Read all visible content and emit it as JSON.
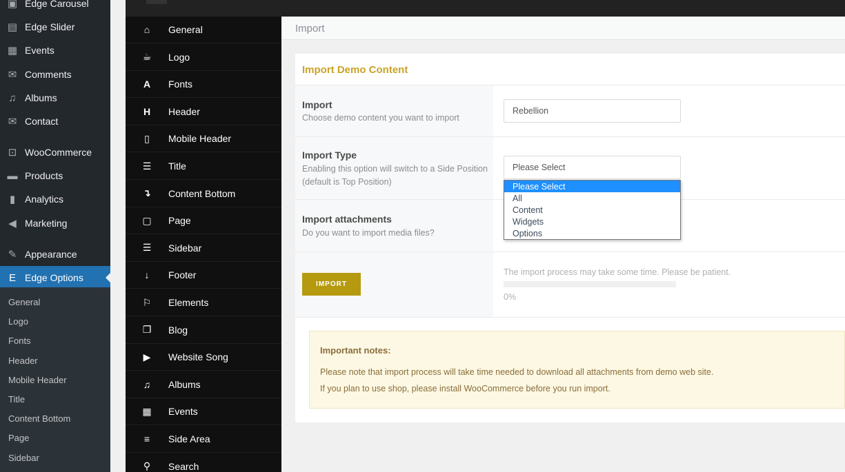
{
  "wp_menu": {
    "items": [
      {
        "label": "Edge Carousel",
        "icon": "carousel-icon",
        "glyph": "▣"
      },
      {
        "label": "Edge Slider",
        "icon": "slider-icon",
        "glyph": "▤"
      },
      {
        "label": "Events",
        "icon": "calendar-icon",
        "glyph": "▦"
      },
      {
        "label": "Comments",
        "icon": "comment-icon",
        "glyph": "✉"
      },
      {
        "label": "Albums",
        "icon": "music-icon",
        "glyph": "♫"
      },
      {
        "label": "Contact",
        "icon": "mail-icon",
        "glyph": "✉"
      },
      {
        "label": "WooCommerce",
        "icon": "woocommerce-icon",
        "glyph": "⊡"
      },
      {
        "label": "Products",
        "icon": "archive-icon",
        "glyph": "▬"
      },
      {
        "label": "Analytics",
        "icon": "bar-chart-icon",
        "glyph": "▮"
      },
      {
        "label": "Marketing",
        "icon": "megaphone-icon",
        "glyph": "◀"
      },
      {
        "label": "Appearance",
        "icon": "paintbrush-icon",
        "glyph": "✎"
      },
      {
        "label": "Edge Options",
        "icon": "edge-logo-icon",
        "glyph": "E"
      }
    ],
    "submenu": [
      "General",
      "Logo",
      "Fonts",
      "Header",
      "Mobile Header",
      "Title",
      "Content Bottom",
      "Page",
      "Sidebar"
    ]
  },
  "edge_nav": [
    {
      "label": "General",
      "icon": "bank-icon",
      "glyph": "⌂"
    },
    {
      "label": "Logo",
      "icon": "coffee-icon",
      "glyph": "☕"
    },
    {
      "label": "Fonts",
      "icon": "font-icon",
      "glyph": "A"
    },
    {
      "label": "Header",
      "icon": "header-icon",
      "glyph": "H"
    },
    {
      "label": "Mobile Header",
      "icon": "mobile-icon",
      "glyph": "▯"
    },
    {
      "label": "Title",
      "icon": "list-alt-icon",
      "glyph": "☰"
    },
    {
      "label": "Content Bottom",
      "icon": "level-down-icon",
      "glyph": "↴"
    },
    {
      "label": "Page",
      "icon": "file-icon",
      "glyph": "▢"
    },
    {
      "label": "Sidebar",
      "icon": "indent-icon",
      "glyph": "☰"
    },
    {
      "label": "Footer",
      "icon": "sort-icon",
      "glyph": "↓"
    },
    {
      "label": "Elements",
      "icon": "flag-icon",
      "glyph": "⚐"
    },
    {
      "label": "Blog",
      "icon": "copy-icon",
      "glyph": "❐"
    },
    {
      "label": "Website Song",
      "icon": "play-circle-icon",
      "glyph": "▶"
    },
    {
      "label": "Albums",
      "icon": "music-icon",
      "glyph": "♫"
    },
    {
      "label": "Events",
      "icon": "calendar-icon",
      "glyph": "▦"
    },
    {
      "label": "Side Area",
      "icon": "bars-icon",
      "glyph": "≡"
    },
    {
      "label": "Search",
      "icon": "search-icon",
      "glyph": "⚲"
    }
  ],
  "page": {
    "header": "Import",
    "panel_title": "Import Demo Content",
    "import": {
      "title": "Import",
      "desc": "Choose demo content you want to import",
      "value": "Rebellion"
    },
    "import_type": {
      "title": "Import Type",
      "desc": "Enabling this option will switch to a Side Position (default is Top Position)",
      "value": "Please Select",
      "options": [
        "Please Select",
        "All",
        "Content",
        "Widgets",
        "Options"
      ]
    },
    "attachments": {
      "title": "Import attachments",
      "desc": "Do you want to import media files?"
    },
    "button": "IMPORT",
    "progress_text": "The import process may take some time. Please be patient.",
    "progress_percent": "0%",
    "progress_value": 0,
    "notes": {
      "title": "Important notes:",
      "line1": "Please note that import process will take time needed to download all attachments from demo web site.",
      "line2": "If you plan to use shop, please install WooCommerce before you run import."
    }
  },
  "colors": {
    "accent": "#c9a227",
    "button": "#b59a10",
    "wp_active": "#2271b1"
  }
}
